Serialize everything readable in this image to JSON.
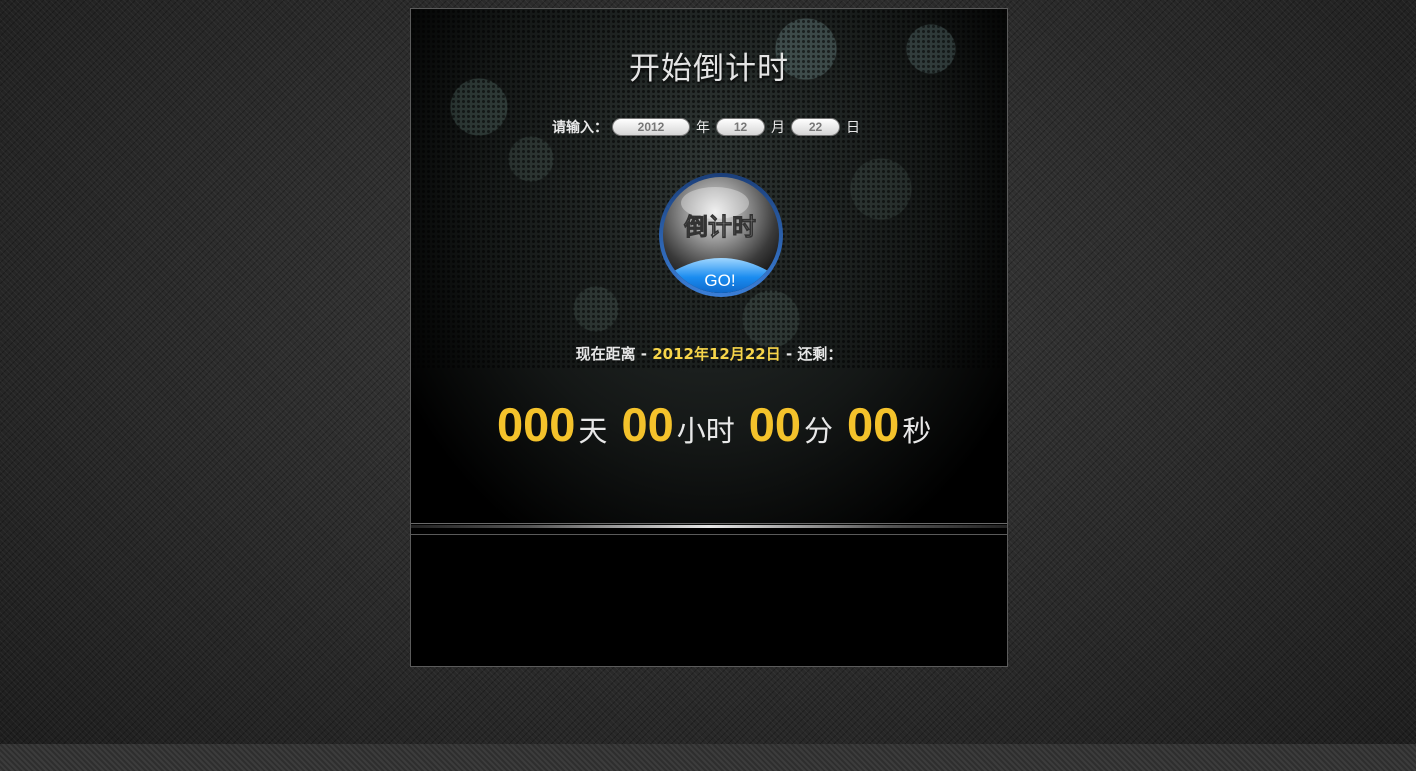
{
  "title": "开始倒计时",
  "input_row": {
    "prompt": "请输入：",
    "year_value": "2012",
    "year_unit": "年",
    "month_value": "12",
    "month_unit": "月",
    "day_value": "22",
    "day_unit": "日"
  },
  "go_button": {
    "top_text": "倒计时",
    "badge_text": "GO!"
  },
  "status": {
    "prefix": "现在距离 - ",
    "target_date": "2012年12月22日",
    "suffix": " - 还剩："
  },
  "countdown": {
    "days": "000",
    "days_unit": "天",
    "hours": "00",
    "hours_unit": "小时",
    "minutes": "00",
    "minutes_unit": "分",
    "seconds": "00",
    "seconds_unit": "秒"
  },
  "colors": {
    "accent_yellow": "#f4c22b",
    "date_yellow": "#f7d54a",
    "button_blue": "#1a8cf0"
  }
}
